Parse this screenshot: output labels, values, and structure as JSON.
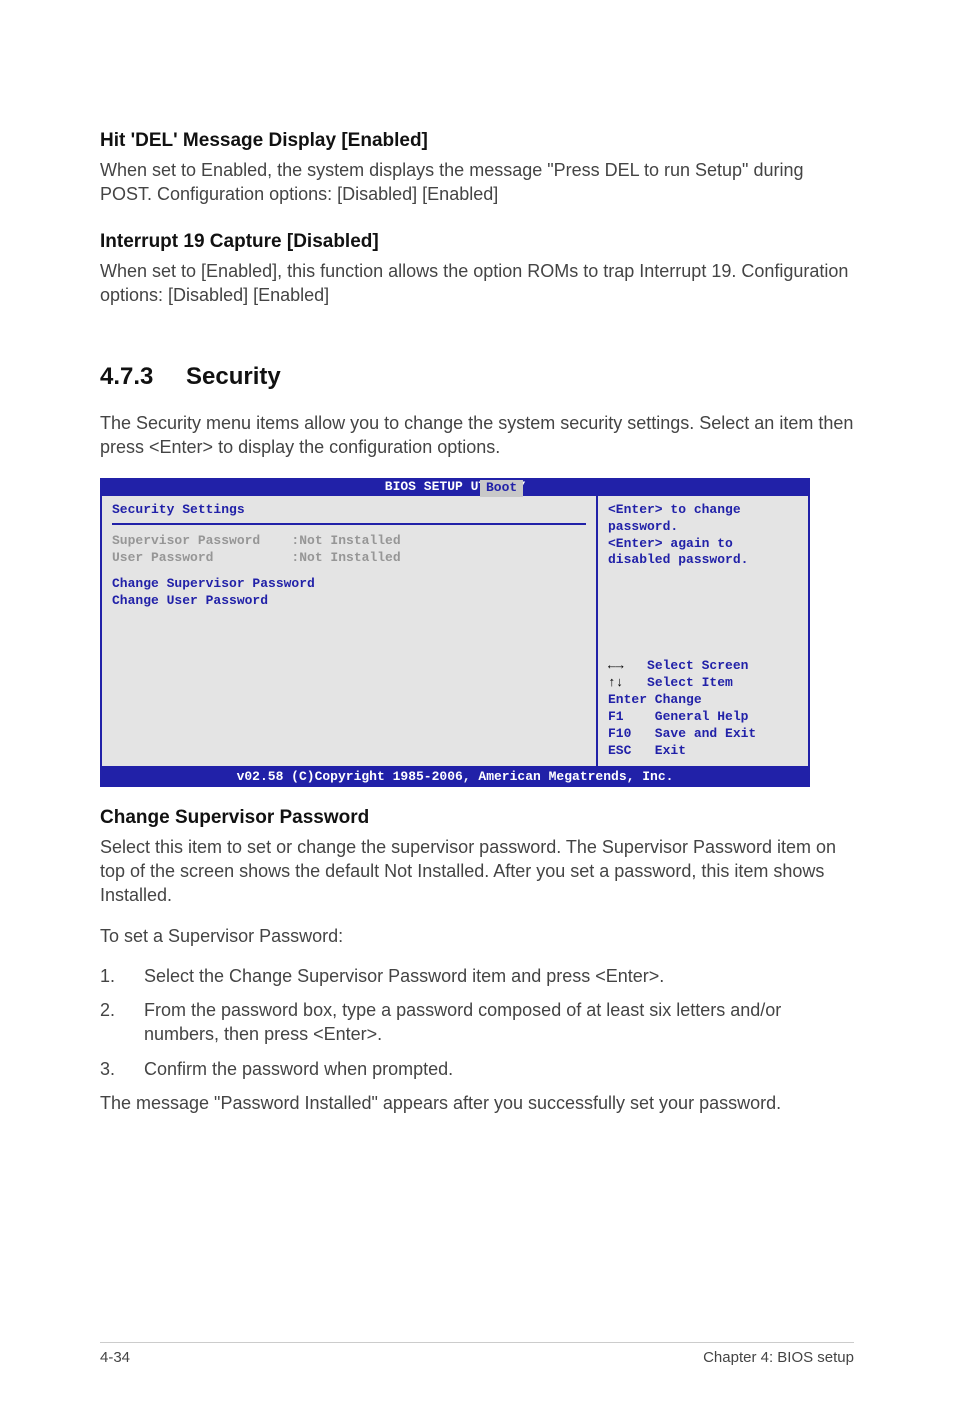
{
  "s1": {
    "heading": "Hit 'DEL' Message Display [Enabled]",
    "body": "When set to Enabled, the system displays the message \"Press DEL to run Setup\" during POST. Configuration options: [Disabled] [Enabled]"
  },
  "s2": {
    "heading": "Interrupt 19 Capture [Disabled]",
    "body": "When set to [Enabled], this function allows the option ROMs to trap Interrupt 19. Configuration options: [Disabled] [Enabled]"
  },
  "h2": {
    "num": "4.7.3",
    "title": "Security"
  },
  "intro": "The Security menu items allow you to change the system security settings. Select an item then press <Enter> to display the configuration options.",
  "bios": {
    "title": "BIOS SETUP UTILITY",
    "tab": "Boot",
    "left": {
      "header": "Security Settings",
      "row1": "Supervisor Password    :Not Installed",
      "row2": "User Password          :Not Installed",
      "m1": "Change Supervisor Password",
      "m2": "Change User Password"
    },
    "right": {
      "help1": "<Enter> to change password.",
      "help2": "<Enter> again to disabled password.",
      "nav": {
        "l1a": "←→",
        "l1b": "   Select Screen",
        "l2a": "↑↓",
        "l2b": "   Select Item",
        "l3": "Enter Change",
        "l4": "F1    General Help",
        "l5": "F10   Save and Exit",
        "l6": "ESC   Exit"
      }
    },
    "footer": "v02.58 (C)Copyright 1985-2006, American Megatrends, Inc."
  },
  "s3": {
    "heading": "Change Supervisor Password",
    "p1": "Select this item to set or change the supervisor password. The Supervisor Password item on top of the screen shows the default Not Installed. After you set a password, this item shows Installed.",
    "p2": "To set a Supervisor Password:",
    "li1": "Select the Change Supervisor Password item and press <Enter>.",
    "li2": "From the password box, type a password composed of at least six letters and/or numbers, then press <Enter>.",
    "li3": "Confirm the password when prompted.",
    "p3": "The message \"Password Installed\" appears after you successfully set your password."
  },
  "footer": {
    "left": "4-34",
    "right": "Chapter 4: BIOS setup"
  }
}
